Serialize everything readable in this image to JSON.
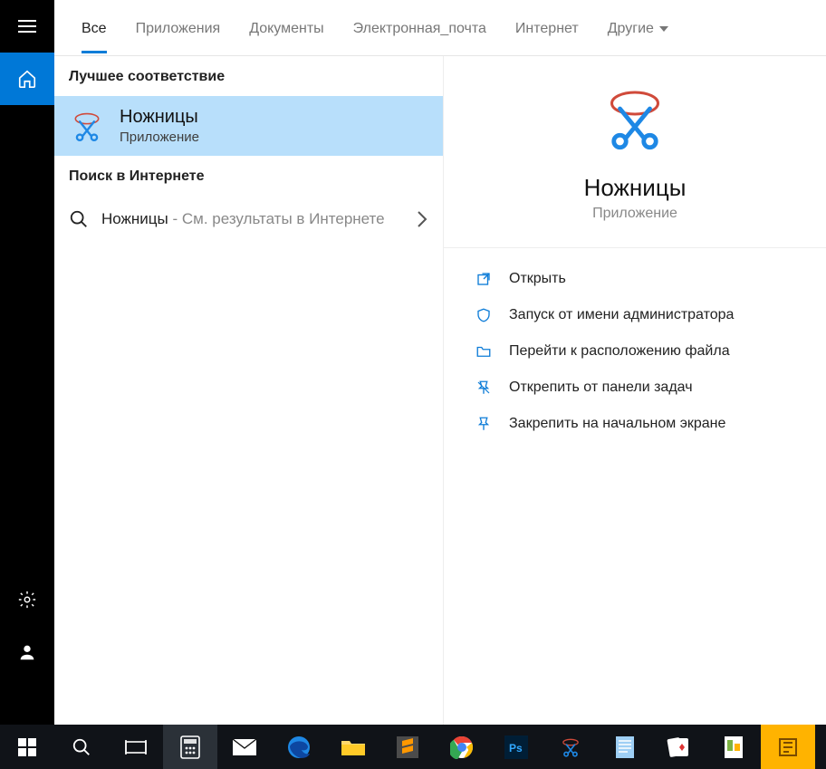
{
  "tabs": {
    "all": "Все",
    "apps": "Приложения",
    "docs": "Документы",
    "email": "Электронная_почта",
    "web": "Интернет",
    "more": "Другие"
  },
  "sections": {
    "best_match": "Лучшее соответствие",
    "web_search": "Поиск в Интернете"
  },
  "best_match": {
    "title": "Ножницы",
    "subtitle": "Приложение"
  },
  "web_result": {
    "query": "Ножницы",
    "suffix": " - См. результаты в Интернете"
  },
  "preview": {
    "title": "Ножницы",
    "subtitle": "Приложение"
  },
  "actions": {
    "open": "Открыть",
    "run_admin": "Запуск от имени администратора",
    "open_location": "Перейти к расположению файла",
    "unpin_taskbar": "Открепить от панели задач",
    "pin_start": "Закрепить на начальном экране"
  },
  "search": {
    "value": "Ножницы"
  }
}
